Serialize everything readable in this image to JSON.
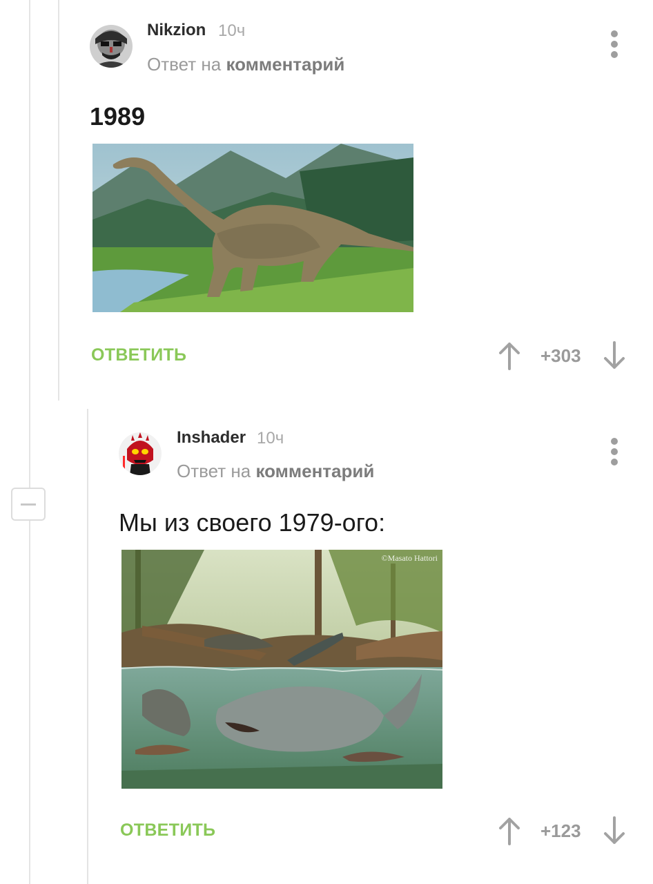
{
  "comments": [
    {
      "author": "Nikzion",
      "time": "10ч",
      "reply_prefix": "Ответ на",
      "reply_link": "комментарий",
      "text": "1989",
      "reply_label": "ОТВЕТИТЬ",
      "score": "+303"
    },
    {
      "author": "Inshader",
      "time": "10ч",
      "reply_prefix": "Ответ на",
      "reply_link": "комментарий",
      "text": "Мы из своего 1979-ого:",
      "image_credit": "©Masato Hattori",
      "reply_label": "ОТВЕТИТЬ",
      "score": "+123"
    }
  ],
  "colors": {
    "reply_accent": "#8ac858",
    "thread_line": "#e4e4e4",
    "muted_text": "#9a9a9a"
  },
  "icons": [
    "more-vert-icon",
    "upvote-arrow-icon",
    "downvote-arrow-icon",
    "collapse-minus-icon"
  ]
}
